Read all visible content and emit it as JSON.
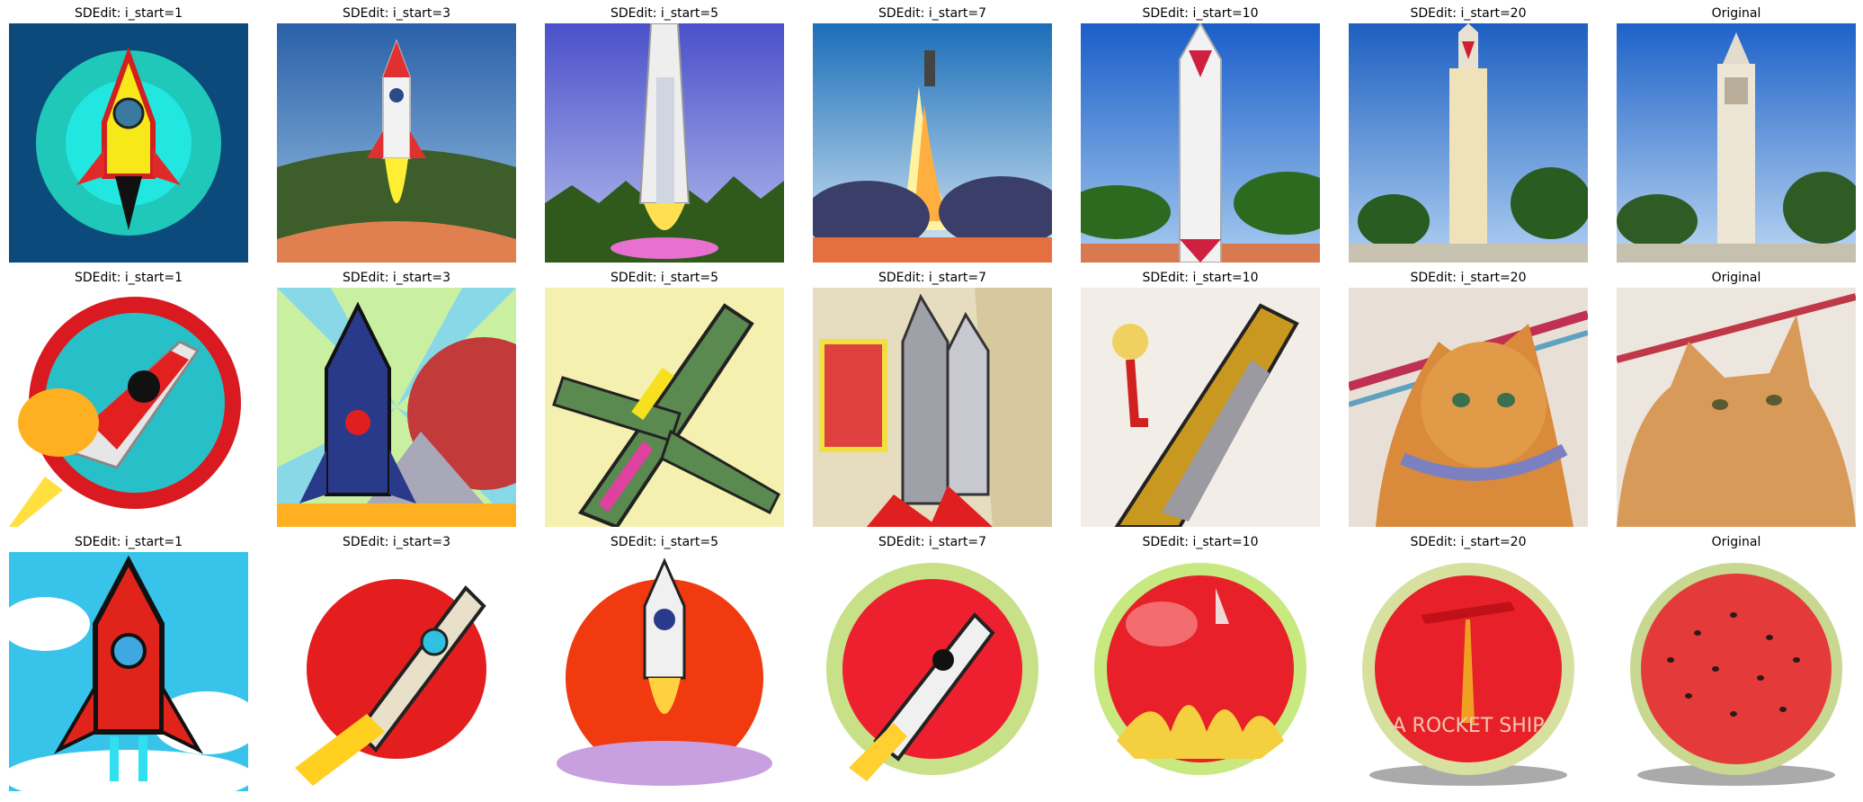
{
  "figure": {
    "rows": [
      {
        "subject": "rocket from Campanile tower",
        "cells": [
          {
            "title": "SDEdit: i_start=1",
            "image": "rocket-icon-circle-dark-bg"
          },
          {
            "title": "SDEdit: i_start=3",
            "image": "rocket-launch-green-hills"
          },
          {
            "title": "SDEdit: i_start=5",
            "image": "space-shuttle-launch-trees"
          },
          {
            "title": "SDEdit: i_start=7",
            "image": "rocket-launch-clouds"
          },
          {
            "title": "SDEdit: i_start=10",
            "image": "rocket-tower-trees"
          },
          {
            "title": "SDEdit: i_start=20",
            "image": "tower-with-rocket-tip"
          },
          {
            "title": "Original",
            "image": "campanile-tower-photo"
          }
        ]
      },
      {
        "subject": "rocket from cat",
        "cells": [
          {
            "title": "SDEdit: i_start=1",
            "image": "rocket-badge-red-circle"
          },
          {
            "title": "SDEdit: i_start=3",
            "image": "rocket-sunburst-mountains"
          },
          {
            "title": "SDEdit: i_start=5",
            "image": "jet-fighter-diagonal"
          },
          {
            "title": "SDEdit: i_start=7",
            "image": "rockets-cluster-fence"
          },
          {
            "title": "SDEdit: i_start=10",
            "image": "boat-rocket-figure"
          },
          {
            "title": "SDEdit: i_start=20",
            "image": "orange-cat-collar"
          },
          {
            "title": "Original",
            "image": "orange-cat-photo"
          }
        ]
      },
      {
        "subject": "rocket from watermelon",
        "cells": [
          {
            "title": "SDEdit: i_start=1",
            "image": "red-rocket-sky"
          },
          {
            "title": "SDEdit: i_start=3",
            "image": "rocket-red-circle-stars"
          },
          {
            "title": "SDEdit: i_start=5",
            "image": "rocket-red-sun-clouds"
          },
          {
            "title": "SDEdit: i_start=7",
            "image": "rocket-badge-green-rim"
          },
          {
            "title": "SDEdit: i_start=10",
            "image": "red-sphere-flames"
          },
          {
            "title": "SDEdit: i_start=20",
            "image": "red-plate-rocket-text",
            "text": "A ROCKET SHIP"
          },
          {
            "title": "Original",
            "image": "watermelon-slice-photo"
          }
        ]
      }
    ]
  }
}
